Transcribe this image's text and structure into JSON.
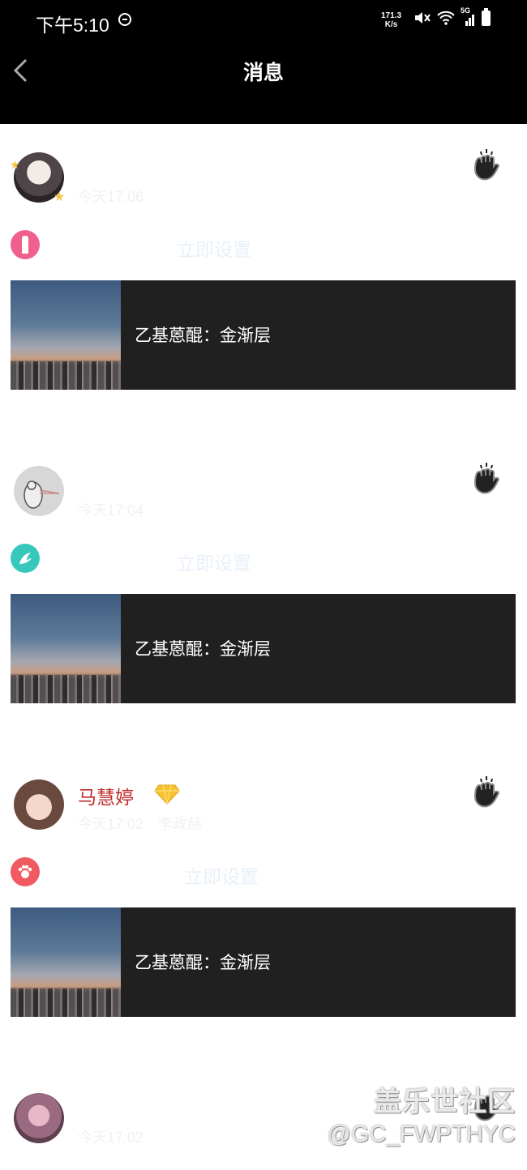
{
  "status_bar": {
    "time": "下午5:10",
    "speed_value": "171.3",
    "speed_unit": "K/s",
    "icons": [
      "dnd-icon",
      "mute-icon",
      "wifi-icon",
      "5g-signal-icon",
      "battery-icon"
    ],
    "signal_label": "5G"
  },
  "header": {
    "title": "消息"
  },
  "cards": [
    {
      "name": "",
      "time": "今天17:06",
      "extra": "",
      "setup_label": "立即设置",
      "app_badge_color": "#f0608c",
      "share_text": "乙基蒽醌：金渐层"
    },
    {
      "name": "",
      "time": "今天17:04",
      "extra": "",
      "setup_label": "立即设置",
      "app_badge_color": "#37c8bd",
      "share_text": "乙基蒽醌：金渐层"
    },
    {
      "name": "马慧婷",
      "time": "今天17:02",
      "extra": "李政赫",
      "setup_label": "立即设置",
      "app_badge_color": "#f05a60",
      "share_text": "乙基蒽醌：金渐层"
    },
    {
      "name": "",
      "time": "今天17:02",
      "extra": ""
    }
  ],
  "watermark": {
    "line1": "盖乐世社区",
    "line2": "@GC_FWPTHYC"
  },
  "colors": {
    "name_color": "#c22a2a",
    "share_bg": "#202020",
    "setup_link": "#e8f0f8"
  }
}
